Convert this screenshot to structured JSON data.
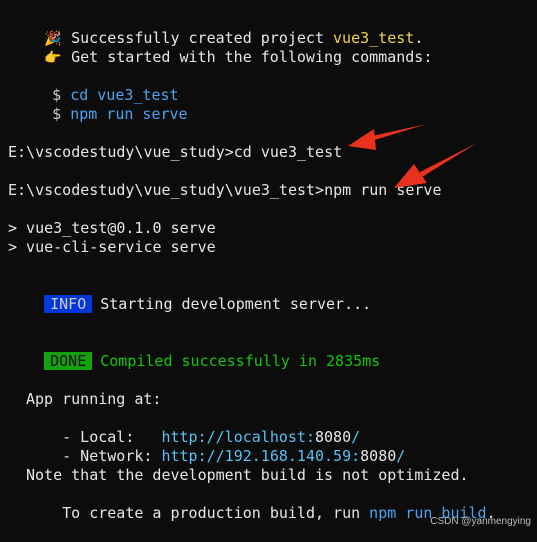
{
  "header": {
    "party_icon": "🎉",
    "point_icon": "👉",
    "created_prefix": "Successfully created project ",
    "project_name": "vue3_test",
    "created_suffix": ".",
    "get_started": "Get started with the following commands:"
  },
  "commands": [
    {
      "prompt": "$",
      "text": "cd vue3_test"
    },
    {
      "prompt": "$",
      "text": "npm run serve"
    }
  ],
  "shell": {
    "line1": "E:\\vscodestudy\\vue_study>cd vue3_test",
    "line2": "E:\\vscodestudy\\vue_study\\vue3_test>npm run serve"
  },
  "npm_output": {
    "script_line": "> vue3_test@0.1.0 serve",
    "command_line": "> vue-cli-service serve"
  },
  "info": {
    "badge": "INFO",
    "message": "Starting development server..."
  },
  "done": {
    "badge": "DONE",
    "message": "Compiled successfully in 2835ms"
  },
  "app": {
    "running": "App running at:",
    "local_label": "- Local:   ",
    "local_url": "http://localhost:",
    "local_port": "8080",
    "local_slash": "/",
    "network_label": "- Network: ",
    "network_url": "http://192.168.140.59:",
    "network_port": "8080",
    "network_slash": "/"
  },
  "note": {
    "line1": "Note that the development build is not optimized.",
    "line2_prefix": "To create a production build, run ",
    "build_cmd": "npm run build",
    "line2_suffix": "."
  },
  "watermark": "CSDN @yanmengying",
  "colors": {
    "background": "#0c0c0c",
    "project_name": "#f2d24a",
    "command": "#4aa3f0",
    "info_badge": "#0037da",
    "done_badge": "#13a10e",
    "success_text": "#16c60c",
    "annotation_arrow": "#e8321e"
  }
}
